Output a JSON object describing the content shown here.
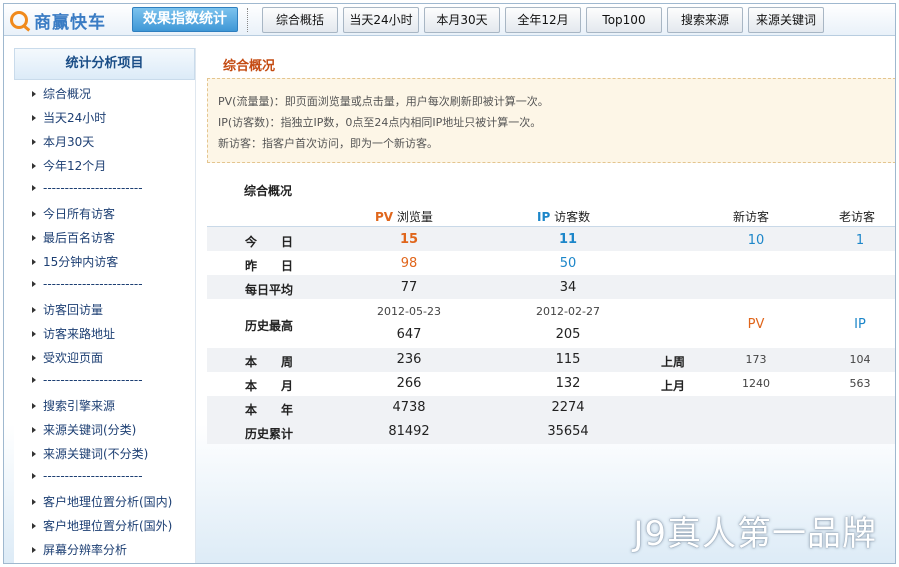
{
  "header": {
    "logo_text": "商赢快车",
    "brand_button": "效果指数统计",
    "nav": [
      "综合概括",
      "当天24小时",
      "本月30天",
      "全年12月",
      "Top100",
      "搜索来源",
      "来源关键词"
    ]
  },
  "sidebar": {
    "title": "统计分析项目",
    "items": [
      "综合概况",
      "当天24小时",
      "本月30天",
      "今年12个月",
      "-----------------------",
      "今日所有访客",
      "最后百名访客",
      "15分钟内访客",
      "-----------------------",
      "访客回访量",
      "访客来路地址",
      "受欢迎页面",
      "-----------------------",
      "搜索引擎来源",
      "来源关键词(分类)",
      "来源关键词(不分类)",
      "-----------------------",
      "客户地理位置分析(国内)",
      "客户地理位置分析(国外)",
      "屏幕分辨率分析"
    ]
  },
  "main": {
    "title": "综合概况",
    "notice": [
      "PV(流量量)：即页面浏览量或点击量，用户每次刷新即被计算一次。",
      "IP(访客数)：指独立IP数，0点至24点内相同IP地址只被计算一次。",
      "新访客：指客户首次访问，即为一个新访客。"
    ],
    "section_title": "综合概况",
    "headers": {
      "pv_tag": "PV",
      "pv_label": "浏览量",
      "ip_tag": "IP",
      "ip_label": "访客数",
      "new_visitors": "新访客",
      "old_visitors": "老访客"
    },
    "rows": {
      "today": {
        "label": "今　　日",
        "pv": "15",
        "ip": "11",
        "new": "10",
        "old": "1"
      },
      "yesterday": {
        "label": "昨　　日",
        "pv": "98",
        "ip": "50"
      },
      "daily_avg": {
        "label": "每日平均",
        "pv": "77",
        "ip": "34"
      },
      "history_max": {
        "label": "历史最高",
        "pv_date": "2012-05-23",
        "pv": "647",
        "ip_date": "2012-02-27",
        "ip": "205",
        "pv_tag": "PV",
        "ip_tag": "IP"
      },
      "this_week": {
        "label": "本　　周",
        "pv": "236",
        "ip": "115",
        "prev_label": "上周",
        "prev_pv": "173",
        "prev_ip": "104"
      },
      "this_month": {
        "label": "本　　月",
        "pv": "266",
        "ip": "132",
        "prev_label": "上月",
        "prev_pv": "1240",
        "prev_ip": "563"
      },
      "this_year": {
        "label": "本　　年",
        "pv": "4738",
        "ip": "2274"
      },
      "total": {
        "label": "历史累计",
        "pv": "81492",
        "ip": "35654"
      }
    },
    "watermark": "J9真人第一品牌"
  }
}
